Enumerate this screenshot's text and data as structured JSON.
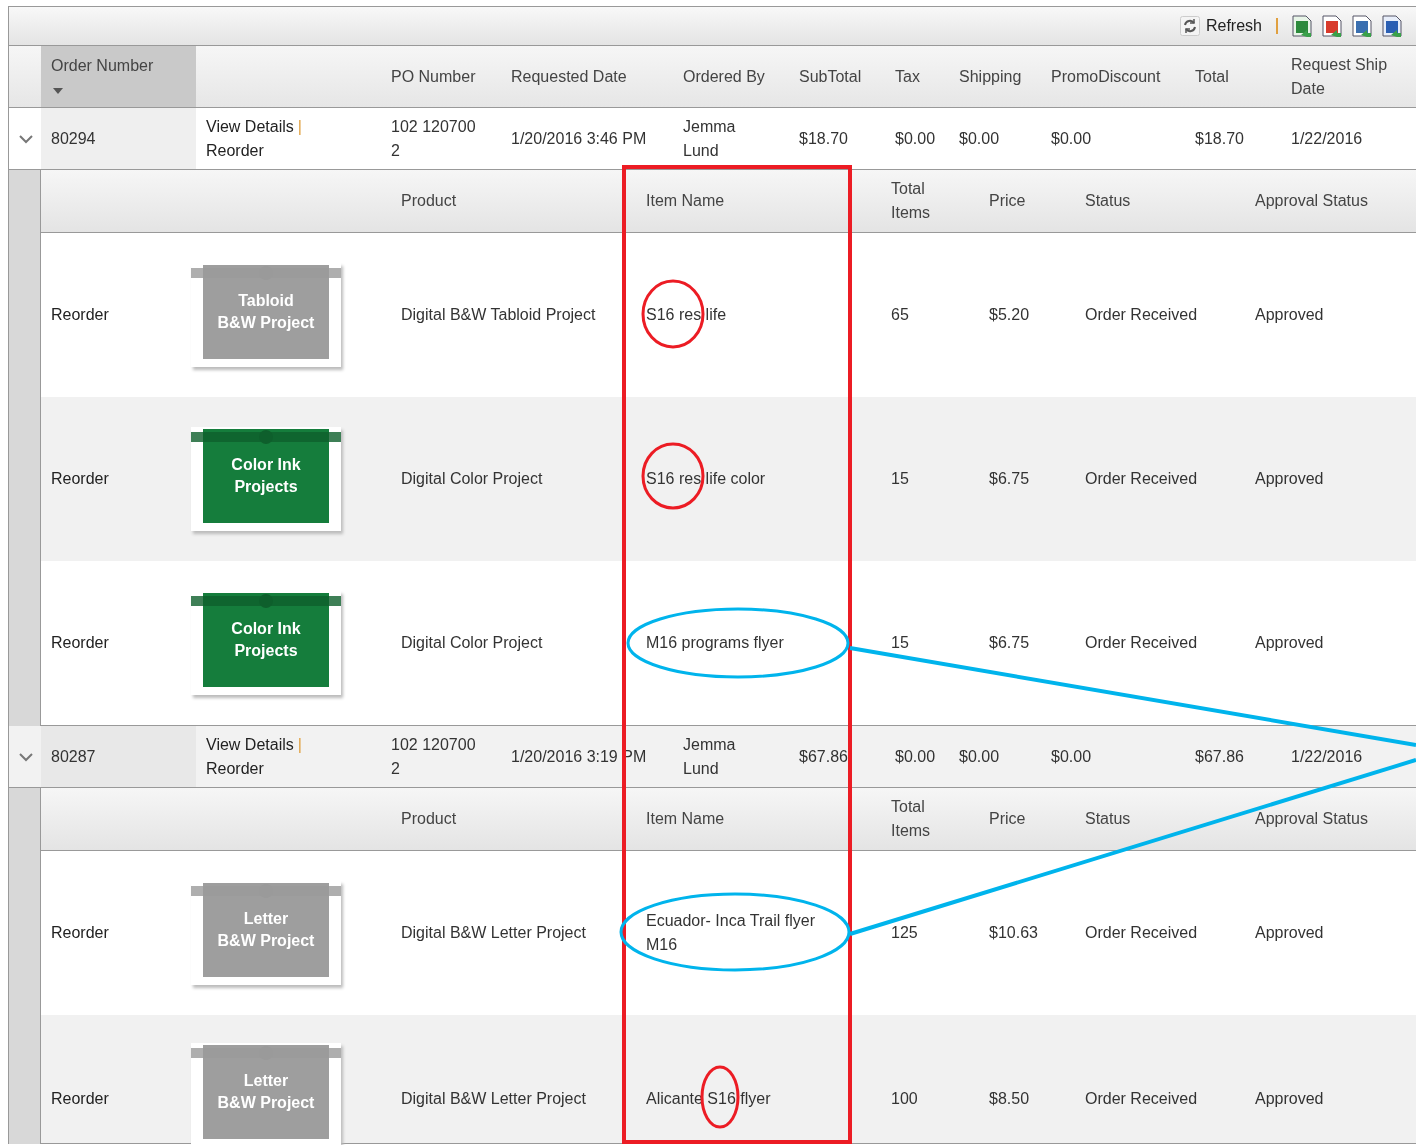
{
  "toolbar": {
    "refresh_label": "Refresh",
    "exports": [
      {
        "kind": "excel"
      },
      {
        "kind": "pdf"
      },
      {
        "kind": "csv"
      },
      {
        "kind": "word"
      }
    ]
  },
  "columns": [
    {
      "label": "Order Number",
      "sorted": true
    },
    {},
    {
      "label": "PO Number"
    },
    {
      "label": "Requested Date"
    },
    {
      "label": "Ordered By"
    },
    {
      "label": "SubTotal"
    },
    {
      "label": "Tax"
    },
    {
      "label": "Shipping"
    },
    {
      "label": "PromoDiscount"
    },
    {
      "label": "Total"
    },
    {
      "label": "Request Ship\nDate"
    }
  ],
  "orders": [
    {
      "order_number": "80294",
      "expanded": true,
      "links": [
        "View Details",
        "Reorder"
      ],
      "separator": "|",
      "po_number": "102 120700\n2",
      "requested_date": "1/20/2016 3:46 PM",
      "ordered_by": "Jemma\nLund",
      "subtotal": "$18.70",
      "tax": "$0.00",
      "shipping": "$0.00",
      "promo_discount": "$0.00",
      "total": "$18.70",
      "ship_date": "1/22/2016",
      "item_columns": [
        null,
        null,
        "Product",
        "Item Name",
        "Total\nItems",
        "Price",
        "Status",
        "Approval Status"
      ],
      "items": [
        {
          "action": "Reorder",
          "thumbnail": {
            "kind": "bw",
            "text": "Tabloid\nB&W Project"
          },
          "product": "Digital B&W Tabloid Project",
          "item_name": "S16 res life",
          "total_items": "65",
          "price": "$5.20",
          "status": "Order Received",
          "approval": "Approved"
        },
        {
          "action": "Reorder",
          "thumbnail": {
            "kind": "color",
            "text": "Color Ink\nProjects"
          },
          "product": "Digital Color Project",
          "item_name": "S16 res life color",
          "total_items": "15",
          "price": "$6.75",
          "status": "Order Received",
          "approval": "Approved"
        },
        {
          "action": "Reorder",
          "thumbnail": {
            "kind": "color",
            "text": "Color Ink\nProjects"
          },
          "product": "Digital Color Project",
          "item_name": "M16 programs flyer",
          "total_items": "15",
          "price": "$6.75",
          "status": "Order Received",
          "approval": "Approved"
        }
      ]
    },
    {
      "order_number": "80287",
      "expanded": true,
      "links": [
        "View Details",
        "Reorder"
      ],
      "separator": "|",
      "po_number": "102 120700\n2",
      "requested_date": "1/20/2016 3:19 PM",
      "ordered_by": "Jemma\nLund",
      "subtotal": "$67.86",
      "tax": "$0.00",
      "shipping": "$0.00",
      "promo_discount": "$0.00",
      "total": "$67.86",
      "ship_date": "1/22/2016",
      "item_columns": [
        null,
        null,
        "Product",
        "Item Name",
        "Total\nItems",
        "Price",
        "Status",
        "Approval Status"
      ],
      "items": [
        {
          "action": "Reorder",
          "thumbnail": {
            "kind": "bw",
            "text": "Letter\nB&W Project"
          },
          "product": "Digital B&W Letter Project",
          "item_name": "Ecuador- Inca Trail flyer\nM16",
          "total_items": "125",
          "price": "$10.63",
          "status": "Order Received",
          "approval": "Approved"
        },
        {
          "action": "Reorder",
          "thumbnail": {
            "kind": "bw",
            "text": "Letter\nB&W Project"
          },
          "product": "Digital B&W Letter Project",
          "item_name": "Alicante S16 flyer",
          "total_items": "100",
          "price": "$8.50",
          "status": "Order Received",
          "approval": "Approved"
        }
      ]
    }
  ],
  "annotations": [
    {
      "kind": "rect",
      "color": "#ec1c24"
    },
    {
      "kind": "ellipse",
      "color": "#ec1c24"
    },
    {
      "kind": "ellipse",
      "color": "#ec1c24"
    },
    {
      "kind": "ellipse",
      "color": "#00b4ec"
    },
    {
      "kind": "ellipse",
      "color": "#00b4ec"
    },
    {
      "kind": "ellipse",
      "color": "#ec1c24"
    },
    {
      "kind": "line",
      "color": "#00b4ec"
    },
    {
      "kind": "line",
      "color": "#00b4ec"
    }
  ]
}
